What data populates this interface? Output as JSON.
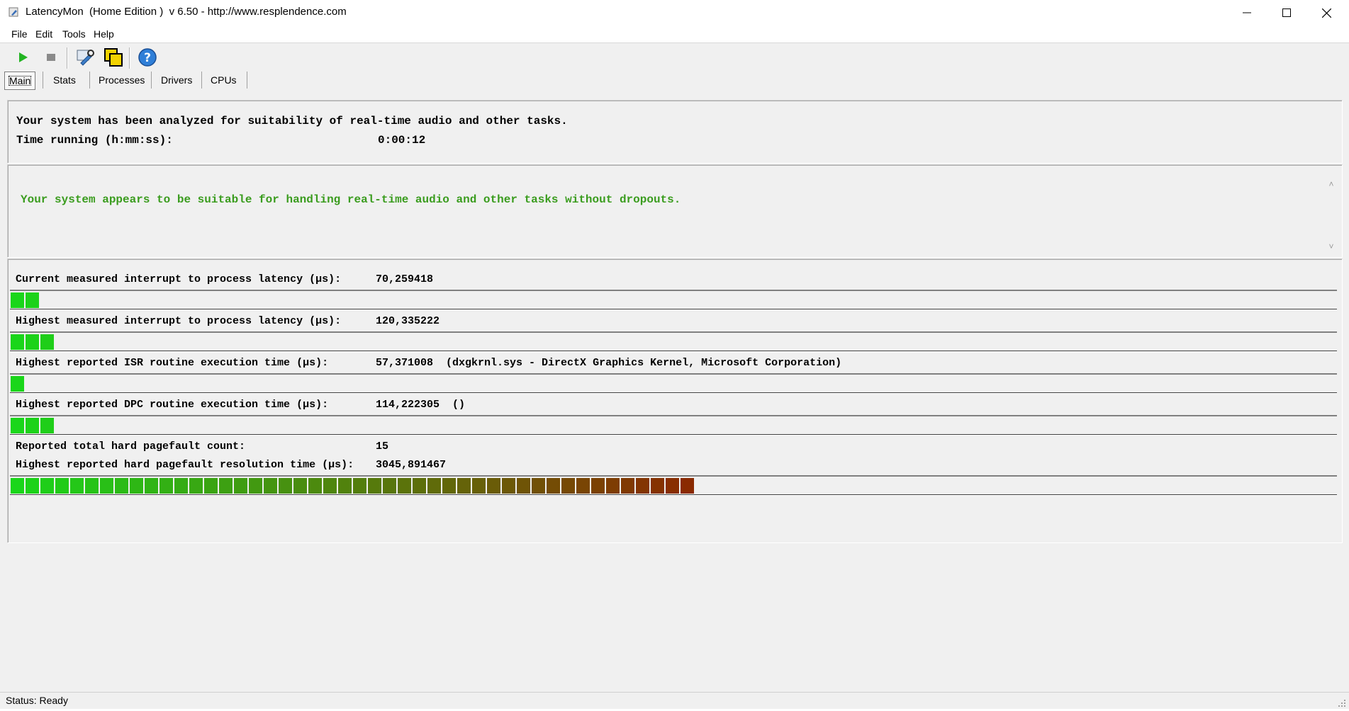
{
  "window": {
    "title": "LatencyMon  (Home Edition )  v 6.50 - http://www.resplendence.com",
    "controls": {
      "minimize": "minimize",
      "maximize": "maximize",
      "close": "close"
    }
  },
  "menu": [
    {
      "label": "File"
    },
    {
      "label": "Edit"
    },
    {
      "label": "Tools"
    },
    {
      "label": "Help"
    }
  ],
  "toolbar": {
    "icons": [
      "play-icon",
      "stop-icon",
      "wrench-icon",
      "windows-icon",
      "help-icon"
    ]
  },
  "tabs": [
    {
      "label": "Main",
      "active": true
    },
    {
      "label": "Stats",
      "active": false
    },
    {
      "label": "Processes",
      "active": false
    },
    {
      "label": "Drivers",
      "active": false
    },
    {
      "label": "CPUs",
      "active": false
    }
  ],
  "summary": {
    "analyzed": "Your system has been analyzed for suitability of real-time audio and other tasks.",
    "time_label": "Time running (h:mm:ss):",
    "time_value": "0:00:12"
  },
  "verdict": {
    "text": "Your system appears to be suitable for handling real-time audio and other tasks without dropouts.",
    "color": "#3a9c1e"
  },
  "metrics": {
    "current_latency": {
      "label": "Current measured interrupt to process latency (µs):",
      "value": "70,259418",
      "meter_blocks": 2
    },
    "highest_latency": {
      "label": "Highest measured interrupt to process latency (µs):",
      "value": "120,335222",
      "meter_blocks": 3
    },
    "isr": {
      "label": "Highest reported ISR routine execution time (µs):",
      "value": "57,371008",
      "detail": "(dxgkrnl.sys - DirectX Graphics Kernel, Microsoft Corporation)",
      "meter_blocks": 1
    },
    "dpc": {
      "label": "Highest reported DPC routine execution time (µs):",
      "value": "114,222305",
      "detail": "()",
      "meter_blocks": 3
    },
    "pagefault_count": {
      "label": "Reported total hard pagefault count:",
      "value": "15"
    },
    "pagefault_time": {
      "label": "Highest reported hard pagefault resolution time (µs):",
      "value": "3045,891467",
      "meter_blocks": 46
    }
  },
  "meter_colors": {
    "start": "#1ad61a",
    "end": "#8a2a00"
  },
  "status": {
    "text": "Status: Ready"
  }
}
